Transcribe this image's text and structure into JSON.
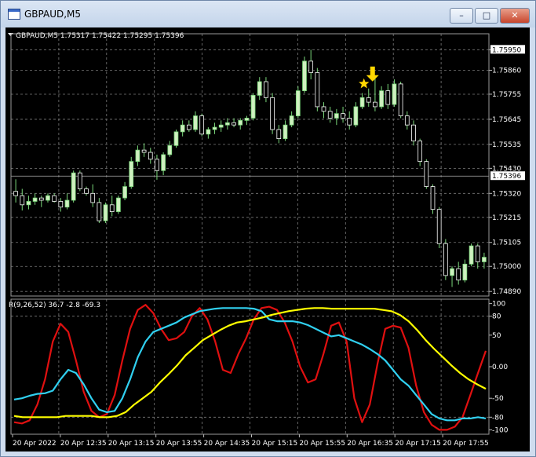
{
  "window": {
    "title": "GBPAUD,M5",
    "controls": {
      "minimize": "–",
      "maximize": "□",
      "close": "✕"
    }
  },
  "chart_data": [
    {
      "type": "candlestick",
      "header": "GBPAUD,M5  1.75317 1.75422 1.75295 1.75396",
      "symbol": "GBPAUD,M5",
      "ylim": [
        1.7487,
        1.7602
      ],
      "price_labels": [
        "1.75950",
        "1.75860",
        "1.75755",
        "1.75645",
        "1.75535",
        "1.75430",
        "1.75320",
        "1.75215",
        "1.75105",
        "1.75000",
        "1.74890"
      ],
      "current_price": "1.75396",
      "current_value": 1.75396,
      "bull_color": "#cff0c0",
      "bear_color": "#ffffff",
      "grid": true,
      "marker": {
        "type": "star-arrow",
        "color": "#ffd700",
        "candle_index": 55
      },
      "ohlc": [
        [
          1.75329,
          1.75382,
          1.7528,
          1.7531
        ],
        [
          1.7531,
          1.7534,
          1.75245,
          1.7527
        ],
        [
          1.7527,
          1.7531,
          1.7525,
          1.75285
        ],
        [
          1.75285,
          1.7532,
          1.7527,
          1.753
        ],
        [
          1.753,
          1.7531,
          1.7526,
          1.7529
        ],
        [
          1.7529,
          1.7532,
          1.7528,
          1.7531
        ],
        [
          1.7531,
          1.7532,
          1.7528,
          1.75285
        ],
        [
          1.75285,
          1.753,
          1.7524,
          1.7526
        ],
        [
          1.7526,
          1.7532,
          1.7525,
          1.7529
        ],
        [
          1.7529,
          1.7542,
          1.7528,
          1.7541
        ],
        [
          1.7541,
          1.7542,
          1.7533,
          1.7534
        ],
        [
          1.7534,
          1.7535,
          1.7531,
          1.7532
        ],
        [
          1.7532,
          1.7536,
          1.7526,
          1.7528
        ],
        [
          1.7528,
          1.753,
          1.7519,
          1.752
        ],
        [
          1.752,
          1.7528,
          1.7519,
          1.7527
        ],
        [
          1.7527,
          1.7531,
          1.7522,
          1.7524
        ],
        [
          1.7524,
          1.7531,
          1.7523,
          1.753
        ],
        [
          1.753,
          1.7537,
          1.7529,
          1.7535
        ],
        [
          1.7535,
          1.7548,
          1.7534,
          1.7546
        ],
        [
          1.7546,
          1.7553,
          1.7544,
          1.7551
        ],
        [
          1.7551,
          1.7554,
          1.7548,
          1.755
        ],
        [
          1.755,
          1.7552,
          1.7545,
          1.7547
        ],
        [
          1.7547,
          1.7549,
          1.7538,
          1.7542
        ],
        [
          1.7542,
          1.755,
          1.754,
          1.7549
        ],
        [
          1.7549,
          1.7555,
          1.7548,
          1.7553
        ],
        [
          1.7553,
          1.756,
          1.7552,
          1.7559
        ],
        [
          1.7559,
          1.7564,
          1.7557,
          1.7562
        ],
        [
          1.7562,
          1.7564,
          1.7559,
          1.756
        ],
        [
          1.756,
          1.7568,
          1.7559,
          1.7566
        ],
        [
          1.7566,
          1.7567,
          1.7557,
          1.7558
        ],
        [
          1.7558,
          1.7561,
          1.7556,
          1.756
        ],
        [
          1.756,
          1.7563,
          1.7558,
          1.7561
        ],
        [
          1.7561,
          1.7564,
          1.7559,
          1.7562
        ],
        [
          1.7562,
          1.7565,
          1.756,
          1.7563
        ],
        [
          1.7563,
          1.7565,
          1.7561,
          1.7562
        ],
        [
          1.7562,
          1.7565,
          1.756,
          1.7564
        ],
        [
          1.7564,
          1.7566,
          1.7562,
          1.7565
        ],
        [
          1.7565,
          1.7576,
          1.7564,
          1.7575
        ],
        [
          1.7575,
          1.7583,
          1.7573,
          1.7581
        ],
        [
          1.7581,
          1.7583,
          1.7572,
          1.7574
        ],
        [
          1.7574,
          1.7576,
          1.7558,
          1.756
        ],
        [
          1.756,
          1.7562,
          1.7554,
          1.7556
        ],
        [
          1.7556,
          1.7564,
          1.7555,
          1.7562
        ],
        [
          1.7562,
          1.7568,
          1.7561,
          1.7566
        ],
        [
          1.7566,
          1.7579,
          1.7565,
          1.7577
        ],
        [
          1.7577,
          1.7592,
          1.7576,
          1.759
        ],
        [
          1.759,
          1.7595,
          1.7582,
          1.7585
        ],
        [
          1.7585,
          1.7587,
          1.7568,
          1.757
        ],
        [
          1.757,
          1.7572,
          1.7565,
          1.7568
        ],
        [
          1.7568,
          1.757,
          1.7563,
          1.7565
        ],
        [
          1.7565,
          1.7569,
          1.7562,
          1.7567
        ],
        [
          1.7567,
          1.757,
          1.7563,
          1.7565
        ],
        [
          1.7565,
          1.7568,
          1.756,
          1.7562
        ],
        [
          1.7562,
          1.7572,
          1.7561,
          1.757
        ],
        [
          1.757,
          1.7576,
          1.7569,
          1.7574
        ],
        [
          1.7574,
          1.7578,
          1.757,
          1.7572
        ],
        [
          1.7572,
          1.7583,
          1.7568,
          1.757
        ],
        [
          1.757,
          1.7579,
          1.7569,
          1.7577
        ],
        [
          1.7577,
          1.758,
          1.7569,
          1.7571
        ],
        [
          1.7571,
          1.7582,
          1.757,
          1.758
        ],
        [
          1.758,
          1.7581,
          1.7565,
          1.7566
        ],
        [
          1.7566,
          1.7568,
          1.756,
          1.7562
        ],
        [
          1.7562,
          1.7564,
          1.7553,
          1.7555
        ],
        [
          1.7555,
          1.7556,
          1.7544,
          1.7546
        ],
        [
          1.7546,
          1.7547,
          1.7534,
          1.7535
        ],
        [
          1.7535,
          1.7536,
          1.7523,
          1.7525
        ],
        [
          1.7525,
          1.7526,
          1.7508,
          1.751
        ],
        [
          1.751,
          1.7512,
          1.7494,
          1.7496
        ],
        [
          1.7496,
          1.75,
          1.7491,
          1.7499
        ],
        [
          1.7499,
          1.7502,
          1.7492,
          1.7494
        ],
        [
          1.7494,
          1.7503,
          1.7493,
          1.7501
        ],
        [
          1.7501,
          1.751,
          1.75,
          1.7509
        ],
        [
          1.7509,
          1.751,
          1.7499,
          1.7502
        ],
        [
          1.7502,
          1.7506,
          1.7499,
          1.7504
        ]
      ]
    },
    {
      "type": "line",
      "header": "R(9,26,52) 36.7 -2.8 -69.3",
      "ylim": [
        -107,
        107
      ],
      "y_ticks": [
        100,
        80,
        50,
        0,
        -50,
        -80,
        -100
      ],
      "tick_labels": [
        "100",
        "80",
        "50",
        "0.00",
        "-50",
        "-80",
        "-100"
      ],
      "level_lines": [
        80,
        -80
      ],
      "x_tick_labels": [
        "20 Apr 2022",
        "20 Apr 12:35",
        "20 Apr 13:15",
        "20 Apr 13:55",
        "20 Apr 14:35",
        "20 Apr 15:15",
        "20 Apr 15:55",
        "20 Apr 16:35",
        "20 Apr 17:15",
        "20 Apr 17:55"
      ],
      "series": [
        {
          "color": "#e01010",
          "values": [
            -88,
            -90,
            -85,
            -60,
            -20,
            40,
            68,
            55,
            10,
            -40,
            -70,
            -80,
            -75,
            -45,
            10,
            60,
            90,
            98,
            85,
            60,
            42,
            45,
            55,
            80,
            93,
            75,
            40,
            -5,
            -10,
            20,
            45,
            75,
            93,
            95,
            90,
            70,
            40,
            0,
            -25,
            -20,
            20,
            65,
            70,
            40,
            -50,
            -88,
            -60,
            5,
            60,
            65,
            62,
            30,
            -30,
            -72,
            -92,
            -100,
            -100,
            -95,
            -80,
            -45,
            -10,
            25
          ]
        },
        {
          "color": "#30d0f0",
          "values": [
            -52,
            -50,
            -46,
            -43,
            -42,
            -38,
            -20,
            -5,
            -10,
            -28,
            -50,
            -68,
            -72,
            -70,
            -50,
            -20,
            15,
            40,
            55,
            60,
            65,
            70,
            78,
            83,
            88,
            90,
            92,
            93,
            93,
            93,
            93,
            92,
            88,
            75,
            72,
            72,
            72,
            70,
            66,
            60,
            54,
            48,
            50,
            45,
            40,
            35,
            28,
            20,
            10,
            -5,
            -20,
            -30,
            -45,
            -60,
            -75,
            -82,
            -85,
            -85,
            -82,
            -82,
            -80,
            -82
          ]
        },
        {
          "color": "#ffff00",
          "values": [
            -78,
            -80,
            -80,
            -80,
            -80,
            -80,
            -78,
            -78,
            -78,
            -78,
            -80,
            -80,
            -78,
            -72,
            -60,
            -50,
            -40,
            -25,
            -12,
            2,
            18,
            30,
            42,
            50,
            58,
            65,
            70,
            72,
            75,
            78,
            82,
            85,
            88,
            90,
            92,
            93,
            93,
            92,
            92,
            92,
            92,
            92,
            92,
            90,
            88,
            82,
            72,
            58,
            42,
            28,
            15,
            2,
            -10,
            -20,
            -28,
            -35
          ]
        }
      ]
    }
  ]
}
